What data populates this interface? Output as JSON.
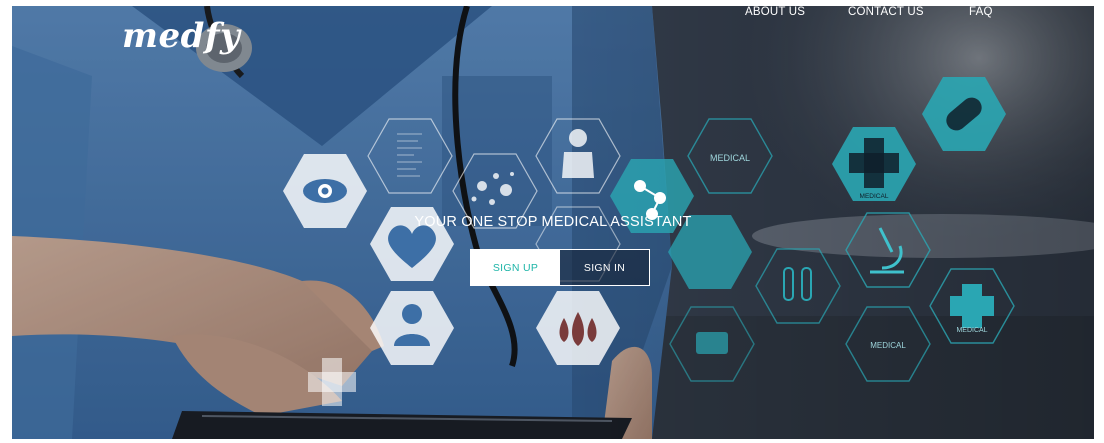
{
  "navbar": {
    "brand": "medfy",
    "links": {
      "about": "ABOUT US",
      "contact": "CONTACT US",
      "faq": "FAQ"
    }
  },
  "hero": {
    "tagline": "YOUR ONE STOP MEDICAL ASSISTANT",
    "signup_label": "SIGN UP",
    "signin_label": "SIGN IN",
    "hex_labels": [
      "MEDICAL",
      "MEDICAL",
      "MEDICAL",
      "MEDICAL"
    ]
  },
  "colors": {
    "accent": "#1fb5a8",
    "hex_fill": "#2aa6b3",
    "scrubs_blue": "#3d6fa6",
    "background_dark": "#2b3340"
  },
  "icons": [
    "eye-icon",
    "heart-icon",
    "person-icon",
    "blood-drops-icon",
    "stethoscope-icon",
    "molecule-icon",
    "medical-cross-icon",
    "pill-icon",
    "microscope-icon",
    "test-tubes-icon",
    "first-aid-kit-icon",
    "document-icon"
  ]
}
